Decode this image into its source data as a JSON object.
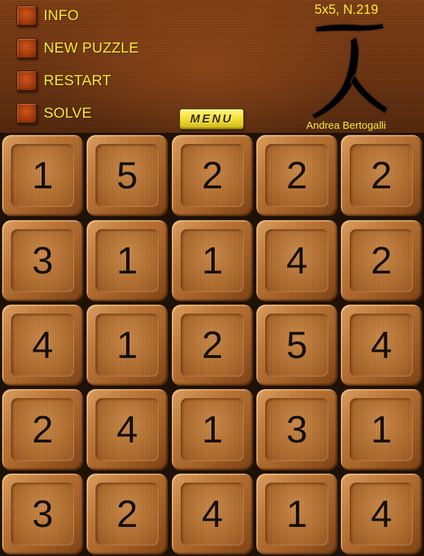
{
  "header": {
    "menu_items": [
      {
        "label": "INFO"
      },
      {
        "label": "NEW PUZZLE"
      },
      {
        "label": "RESTART"
      },
      {
        "label": "SOLVE"
      }
    ],
    "puzzle_title": "5x5, N.219",
    "author": "Andrea Bertogalli",
    "menu_button": "MENU",
    "logo_icon": "kanji-hitotsu-hito-icon"
  },
  "board": {
    "rows": 5,
    "cols": 5,
    "cells": [
      [
        "1",
        "5",
        "2",
        "2",
        "2"
      ],
      [
        "3",
        "1",
        "1",
        "4",
        "2"
      ],
      [
        "4",
        "1",
        "2",
        "5",
        "4"
      ],
      [
        "2",
        "4",
        "1",
        "3",
        "1"
      ],
      [
        "3",
        "2",
        "4",
        "1",
        "4"
      ]
    ]
  },
  "colors": {
    "label_yellow": "#f6ec34",
    "wood_dark": "#4f240a",
    "tile_wood": "#bb7434",
    "number_ink": "#151008"
  }
}
